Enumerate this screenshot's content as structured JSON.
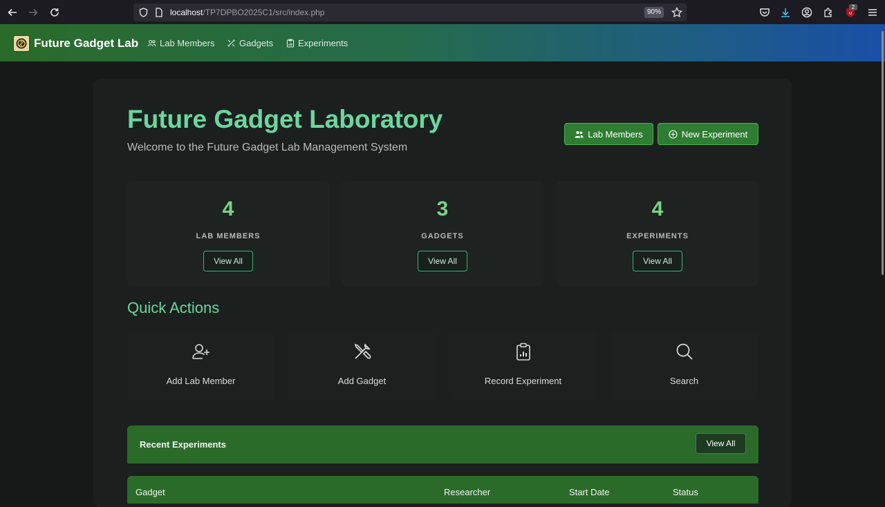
{
  "browser": {
    "url_host": "localhost",
    "url_path": "/TP7DPBO2025C1/src/index.php",
    "zoom": "90%",
    "extension_badge": "2"
  },
  "navbar": {
    "brand": "Future Gadget Lab",
    "links": [
      "Lab Members",
      "Gadgets",
      "Experiments"
    ]
  },
  "header": {
    "title": "Future Gadget Laboratory",
    "subtitle": "Welcome to the Future Gadget Lab Management System",
    "buttons": [
      "Lab Members",
      "New Experiment"
    ]
  },
  "stats": [
    {
      "value": "4",
      "label": "LAB MEMBERS",
      "button": "View All"
    },
    {
      "value": "3",
      "label": "GADGETS",
      "button": "View All"
    },
    {
      "value": "4",
      "label": "EXPERIMENTS",
      "button": "View All"
    }
  ],
  "quick_actions": {
    "title": "Quick Actions",
    "items": [
      {
        "label": "Add Lab Member",
        "icon": "user-plus-icon"
      },
      {
        "label": "Add Gadget",
        "icon": "tools-icon"
      },
      {
        "label": "Record Experiment",
        "icon": "clipboard-chart-icon"
      },
      {
        "label": "Search",
        "icon": "search-icon"
      }
    ]
  },
  "recent": {
    "title": "Recent Experiments",
    "button": "View All",
    "columns": [
      "Gadget",
      "Researcher",
      "Start Date",
      "Status"
    ]
  },
  "colors": {
    "accent": "#6cd6a0",
    "brand_green": "#2e7d32",
    "background": "#151a18"
  }
}
